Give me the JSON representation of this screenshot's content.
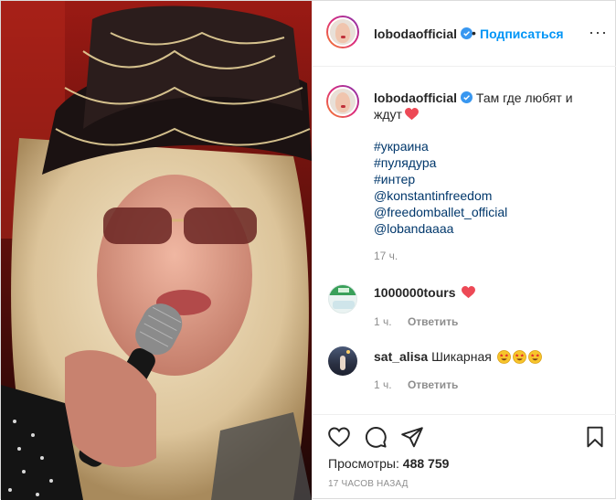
{
  "post": {
    "username": "lobodaofficial",
    "separator": "•",
    "follow_label": "Подписаться",
    "more_label": "···",
    "caption_text": "Там где любят и ждут",
    "hashtags": [
      "#украина",
      "#пулядура",
      "#интер"
    ],
    "mentions": [
      "@konstantinfreedom",
      "@freedomballet_official",
      "@lobandaaaa"
    ],
    "caption_time": "17 ч."
  },
  "comments": [
    {
      "username": "1000000tours",
      "text": "",
      "time": "1 ч.",
      "reply_label": "Ответить"
    },
    {
      "username": "sat_alisa",
      "text": "Шикарная",
      "time": "1 ч.",
      "reply_label": "Ответить"
    }
  ],
  "footer": {
    "views_label": "Просмотры:",
    "views_count": "488 759",
    "posted_ago": "17 ЧАСОВ НАЗАД"
  },
  "icons": {
    "verified": "verified-badge-icon",
    "heart": "red-heart-icon",
    "star_eyes": "star-struck-emoji-icon",
    "like": "heart-outline-icon",
    "comment": "comment-bubble-icon",
    "share": "paper-plane-icon",
    "save": "bookmark-icon"
  },
  "colors": {
    "link": "#00376b",
    "follow": "#0095f6",
    "verified": "#3897f0",
    "heart": "#ed4956"
  }
}
